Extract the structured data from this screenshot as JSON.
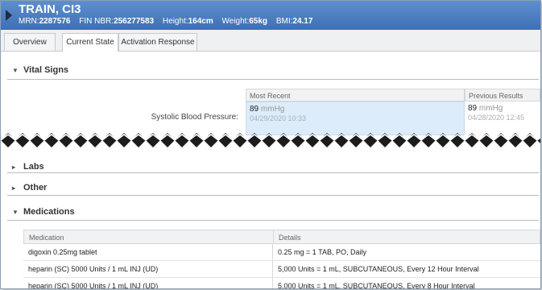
{
  "banner": {
    "patient_name": "TRAIN, CI3",
    "mrn_label": "MRN:",
    "mrn_value": "2287576",
    "fin_label": "FIN NBR:",
    "fin_value": "256277583",
    "height_label": "Height:",
    "height_value": "164cm",
    "weight_label": "Weight:",
    "weight_value": "65kg",
    "bmi_label": "BMI:",
    "bmi_value": "24.17"
  },
  "tabs": [
    {
      "label": "Overview"
    },
    {
      "label": "Current State"
    },
    {
      "label": "Activation Response"
    }
  ],
  "sections": {
    "vital_signs": "Vital Signs",
    "labs": "Labs",
    "other": "Other",
    "medications": "Medications"
  },
  "vitals": {
    "col_recent": "Most Recent",
    "col_previous": "Previous Results",
    "row_label": "Systolic Blood Pressure:",
    "recent_value": "89",
    "recent_unit": "mmHg",
    "recent_date": "04/29/2020 10:33",
    "previous_value": "89",
    "previous_unit": "mmHg",
    "previous_date": "04/28/2020 12:45"
  },
  "medications": {
    "col_medication": "Medication",
    "col_details": "Details",
    "rows": [
      {
        "medication": "digoxin 0.25mg tablet",
        "details": "0.25 mg = 1 TAB, PO, Daily"
      },
      {
        "medication": "heparin (SC) 5000 Units / 1 mL INJ (UD)",
        "details": "5,000 Units = 1 mL, SUBCUTANEOUS, Every 12 Hour Interval"
      },
      {
        "medication": "heparin (SC) 5000 Units / 1 mL INJ (UD)",
        "details": "5,000 Units = 1 mL, SUBCUTANEOUS, Every 8 Hour Interval"
      }
    ]
  }
}
